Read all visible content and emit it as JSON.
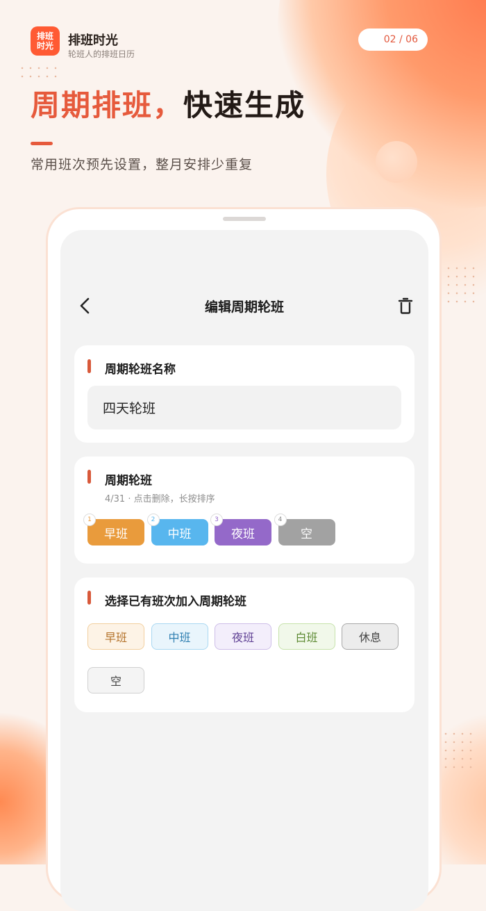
{
  "brand": {
    "logo_text": "排班时光",
    "name": "排班时光",
    "tagline": "轮班人的排班日历"
  },
  "page_indicator": "02 / 06",
  "headline": {
    "accent": "周期排班",
    "comma": "，",
    "rest": "快速生成"
  },
  "subheadline": "常用班次预先设置，整月安排少重复",
  "screen": {
    "nav": {
      "back_icon": "chevron-left-icon",
      "title": "编辑周期轮班",
      "delete_icon": "trash-icon"
    },
    "name_section": {
      "title": "周期轮班名称",
      "value": "四天轮班"
    },
    "cycle_section": {
      "title": "周期轮班",
      "hint": "4/31 · 点击删除，长按排序",
      "shifts": [
        {
          "index": "1",
          "label": "早班",
          "color": "#e99b3c",
          "num_color": "#e99b3c"
        },
        {
          "index": "2",
          "label": "中班",
          "color": "#58b6ee",
          "num_color": "#58b6ee"
        },
        {
          "index": "3",
          "label": "夜班",
          "color": "#9469c9",
          "num_color": "#9469c9"
        },
        {
          "index": "4",
          "label": "空",
          "color": "#a2a2a2",
          "num_color": "#888888"
        }
      ]
    },
    "choose_section": {
      "title": "选择已有班次加入周期轮班",
      "options": [
        {
          "label": "早班",
          "bg": "#fdf3e6",
          "border": "#f2cf9e",
          "color": "#b4722a"
        },
        {
          "label": "中班",
          "bg": "#e9f5fc",
          "border": "#a9d8f2",
          "color": "#2f7fb1"
        },
        {
          "label": "夜班",
          "bg": "#f3eefb",
          "border": "#cdbde8",
          "color": "#5e3f93"
        },
        {
          "label": "白班",
          "bg": "#f1f8ea",
          "border": "#c6e2ab",
          "color": "#5d8a33"
        },
        {
          "label": "休息",
          "bg": "#ececec",
          "border": "#a8a8a8",
          "color": "#444444"
        },
        {
          "label": "空",
          "bg": "#f4f4f4",
          "border": "#d0d0d0",
          "color": "#444444"
        }
      ]
    }
  }
}
